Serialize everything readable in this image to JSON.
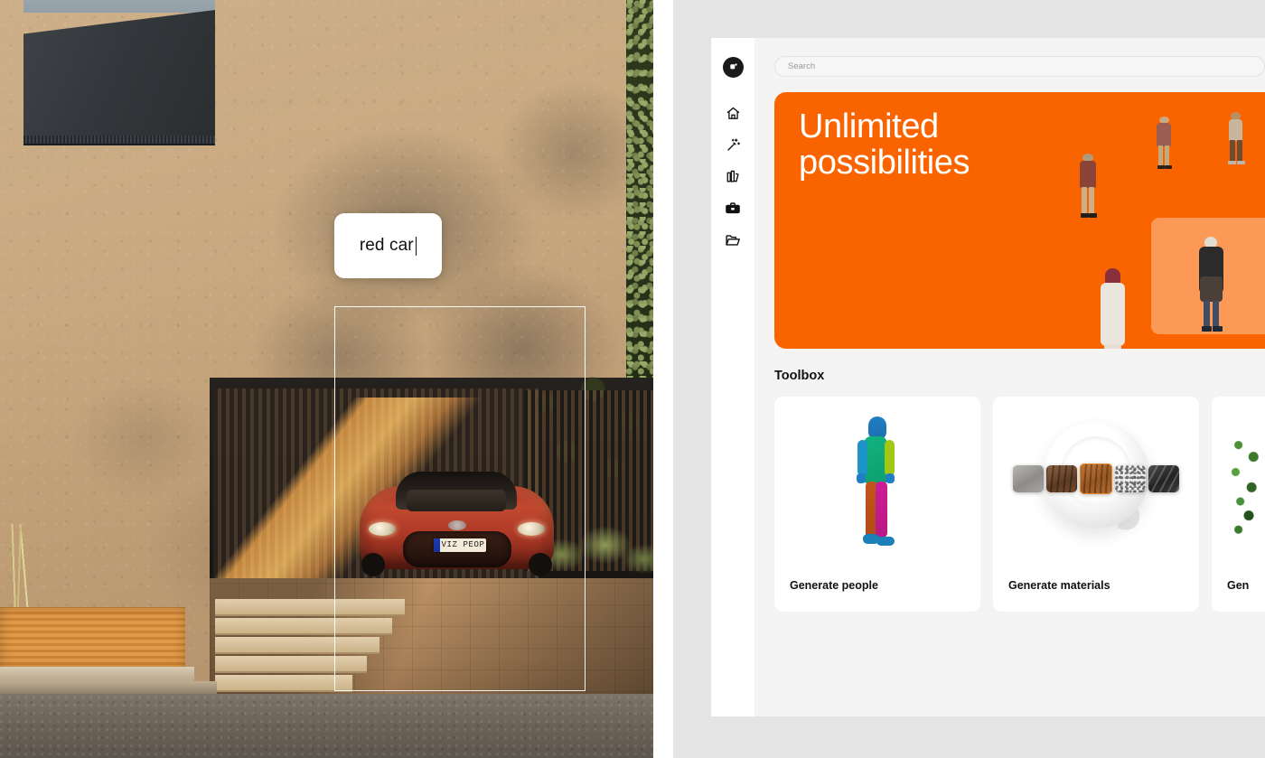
{
  "scene": {
    "prompt_input": {
      "value": "red car",
      "caret": true
    },
    "license_plate": "VIZ PEOP",
    "selection_label": "selection-rectangle"
  },
  "app": {
    "rail": {
      "logo": "app-logo-icon",
      "items": [
        {
          "id": "home",
          "icon": "home-icon",
          "label": "Home"
        },
        {
          "id": "magic",
          "icon": "magic-wand-icon",
          "label": "Magic"
        },
        {
          "id": "library",
          "icon": "library-icon",
          "label": "Library"
        },
        {
          "id": "toolbox",
          "icon": "toolbox-icon",
          "label": "Toolbox"
        },
        {
          "id": "projects",
          "icon": "folder-icon",
          "label": "Projects"
        }
      ]
    },
    "search": {
      "placeholder": "Search",
      "value": ""
    },
    "hero": {
      "title_line1": "Unlimited",
      "title_line2": "possibilities",
      "background_color": "#FA6400",
      "highlight_card_color": "rgba(255,255,255,0.34)"
    },
    "toolbox": {
      "section_title": "Toolbox",
      "cards": [
        {
          "id": "generate-people",
          "label": "Generate people",
          "art": "colorful-walking-person"
        },
        {
          "id": "generate-materials",
          "label": "Generate materials",
          "art": "cup-with-material-swatches"
        },
        {
          "id": "generate-vegetation",
          "label": "Gen",
          "art": "green-shrub"
        }
      ]
    },
    "colors": {
      "accent": "#FA6400",
      "panel": "#f4f4f4",
      "rail": "#ffffff",
      "window": "#e4e4e4",
      "card": "#ffffff",
      "text": "#111111",
      "muted": "#9a9a9a"
    }
  }
}
